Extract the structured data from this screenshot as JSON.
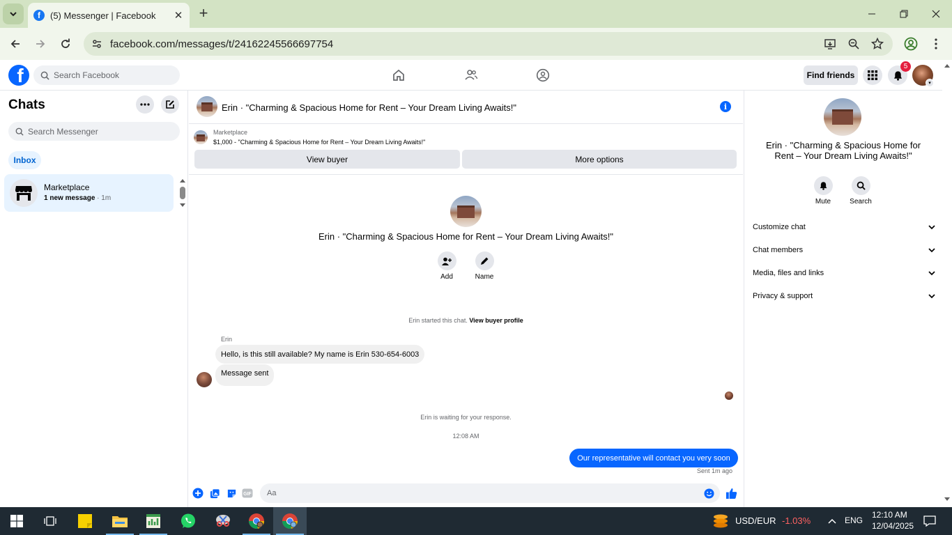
{
  "browser": {
    "tab_title": "(5) Messenger | Facebook",
    "url": "facebook.com/messages/t/24162245566697754"
  },
  "fb_header": {
    "search_placeholder": "Search Facebook",
    "find_friends": "Find friends",
    "notification_count": "5"
  },
  "left": {
    "title": "Chats",
    "search_placeholder": "Search Messenger",
    "filter_inbox": "Inbox",
    "chats": [
      {
        "name": "Marketplace",
        "preview": "1 new message",
        "time": "· 1m"
      }
    ]
  },
  "conversation": {
    "title": "Erin · \"Charming & Spacious Home for Rent – Your Dream Living Awaits!\"",
    "marketplace_label": "Marketplace",
    "listing": "$1,000 - \"Charming & Spacious Home for Rent – Your Dream Living Awaits!\"",
    "view_buyer": "View buyer",
    "more_options": "More options",
    "intro_actions": {
      "add": "Add",
      "name": "Name"
    },
    "started_text": "Erin started this chat.",
    "view_buyer_profile": "View buyer profile",
    "sender_name": "Erin",
    "messages_in": [
      "Hello, is this still available? My name is Erin 530-654-6003",
      "Message sent"
    ],
    "waiting_text": "Erin is waiting for your response.",
    "timestamp": "12:08 AM",
    "message_out": "Our representative will contact you very soon",
    "sent_status": "Sent 1m ago",
    "composer_placeholder": "Aa"
  },
  "details": {
    "title": "Erin · \"Charming & Spacious Home for Rent – Your Dream Living Awaits!\"",
    "mute": "Mute",
    "search": "Search",
    "sections": [
      "Customize chat",
      "Chat members",
      "Media, files and links",
      "Privacy & support"
    ]
  },
  "taskbar": {
    "ticker": "USD/EUR",
    "change": "-1.03%",
    "lang": "ENG",
    "time": "12:10 AM",
    "date": "12/04/2025"
  }
}
